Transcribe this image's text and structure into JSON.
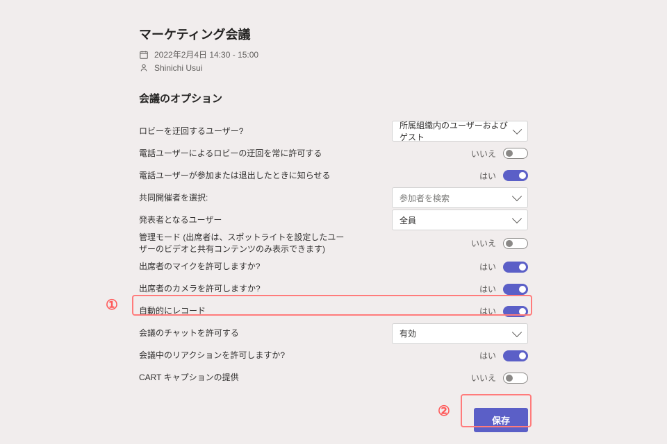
{
  "header": {
    "title": "マーケティング会議",
    "datetime": "2022年2月4日 14:30 - 15:00",
    "organizer": "Shinichi Usui"
  },
  "section_heading": "会議のオプション",
  "state_labels": {
    "on": "はい",
    "off": "いいえ"
  },
  "rows": {
    "lobby_bypass": {
      "label": "ロビーを迂回するユーザー?",
      "selected": "所属組織内のユーザーおよびゲスト"
    },
    "phone_lobby_always": {
      "label": "電話ユーザーによるロビーの迂回を常に許可する",
      "state": "off"
    },
    "phone_join_notify": {
      "label": "電話ユーザーが参加または退出したときに知らせる",
      "state": "on"
    },
    "co_organizers": {
      "label": "共同開催者を選択:",
      "placeholder": "参加者を検索"
    },
    "presenters": {
      "label": "発表者となるユーザー",
      "selected": "全員"
    },
    "spotlight_mode": {
      "label": "管理モード (出席者は、スポットライトを設定したユーザーのビデオと共有コンテンツのみ表示できます)",
      "state": "off"
    },
    "allow_mic": {
      "label": "出席者のマイクを許可しますか?",
      "state": "on"
    },
    "allow_camera": {
      "label": "出席者のカメラを許可しますか?",
      "state": "on"
    },
    "auto_record": {
      "label": "自動的にレコード",
      "state": "on"
    },
    "meeting_chat": {
      "label": "会議のチャットを許可する",
      "selected": "有効"
    },
    "allow_reactions": {
      "label": "会議中のリアクションを許可しますか?",
      "state": "on"
    },
    "cart_captions": {
      "label": "CART キャプションの提供",
      "state": "off"
    }
  },
  "save_label": "保存",
  "annotations": {
    "n1": "①",
    "n2": "②"
  }
}
